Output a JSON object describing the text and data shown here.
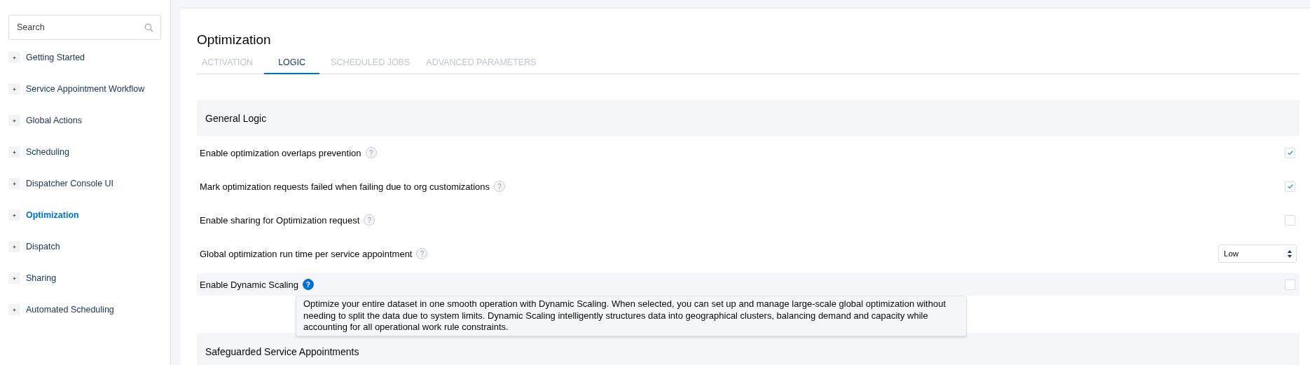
{
  "sidebar": {
    "search": {
      "placeholder": "Search"
    },
    "items": [
      {
        "label": "Getting Started",
        "selected": false
      },
      {
        "label": "Service Appointment Workflow",
        "selected": false
      },
      {
        "label": "Global Actions",
        "selected": false
      },
      {
        "label": "Scheduling",
        "selected": false
      },
      {
        "label": "Dispatcher Console UI",
        "selected": false
      },
      {
        "label": "Optimization",
        "selected": true
      },
      {
        "label": "Dispatch",
        "selected": false
      },
      {
        "label": "Sharing",
        "selected": false
      },
      {
        "label": "Automated Scheduling",
        "selected": false
      }
    ]
  },
  "page": {
    "title": "Optimization",
    "tabs": [
      {
        "label": "ACTIVATION",
        "selected": false
      },
      {
        "label": "LOGIC",
        "selected": true
      },
      {
        "label": "SCHEDULED JOBS",
        "selected": false
      },
      {
        "label": "ADVANCED PARAMETERS",
        "selected": false
      }
    ],
    "sections": [
      {
        "title": "General Logic",
        "rows": [
          {
            "kind": "checkbox",
            "label": "Enable optimization overlaps prevention",
            "help": "?",
            "checked": true,
            "help_active": false
          },
          {
            "kind": "checkbox",
            "label": "Mark optimization requests failed when failing due to org customizations",
            "help": "?",
            "checked": true,
            "help_active": false
          },
          {
            "kind": "checkbox",
            "label": "Enable sharing for Optimization request",
            "help": "?",
            "checked": false,
            "help_active": false
          },
          {
            "kind": "select",
            "label": "Global optimization run time per service appointment",
            "help": "?",
            "value": "Low",
            "help_active": false
          },
          {
            "kind": "checkbox",
            "label": "Enable Dynamic Scaling",
            "help": "?",
            "checked": false,
            "help_active": true,
            "tooltip": "Optimize your entire dataset in one smooth operation with Dynamic Scaling. When selected, you can set up and manage large-scale global optimization without needing to split the data due to system limits. Dynamic Scaling intelligently structures data into geographical clusters, balancing demand and capacity while accounting for all operational work rule constraints."
          }
        ]
      },
      {
        "title": "Safeguarded Service Appointments"
      }
    ]
  }
}
